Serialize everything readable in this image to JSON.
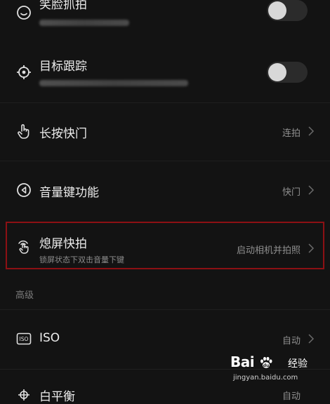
{
  "settings": {
    "face_shot": {
      "title": "笑脸抓拍",
      "enabled": false
    },
    "target_tracking": {
      "title": "目标跟踪",
      "enabled": false
    },
    "long_press_shutter": {
      "title": "长按快门",
      "value": "连拍"
    },
    "volume_key": {
      "title": "音量键功能",
      "value": "快门"
    },
    "screen_off_snap": {
      "title": "熄屏快拍",
      "subtitle": "锁屏状态下双击音量下键",
      "value": "启动相机并拍照"
    },
    "advanced_header": "高级",
    "iso": {
      "title": "ISO",
      "value": "自动"
    },
    "white_balance": {
      "title": "白平衡",
      "value": "自动"
    }
  },
  "watermark": {
    "brand": "Bai",
    "brand_suffix": "",
    "label": "经验",
    "url": "jingyan.baidu.com"
  },
  "colors": {
    "background": "#131313",
    "highlight_border": "#8c1014",
    "text_primary": "#ececec",
    "text_secondary": "#8f8f8f"
  },
  "icons": {
    "face_shot": "smile-icon",
    "target_tracking": "crosshair-icon",
    "long_press_shutter": "hand-pointer-icon",
    "volume_key": "volume-play-icon",
    "screen_off_snap": "touch-wave-icon",
    "iso": "iso-icon",
    "white_balance": "white-balance-icon"
  }
}
